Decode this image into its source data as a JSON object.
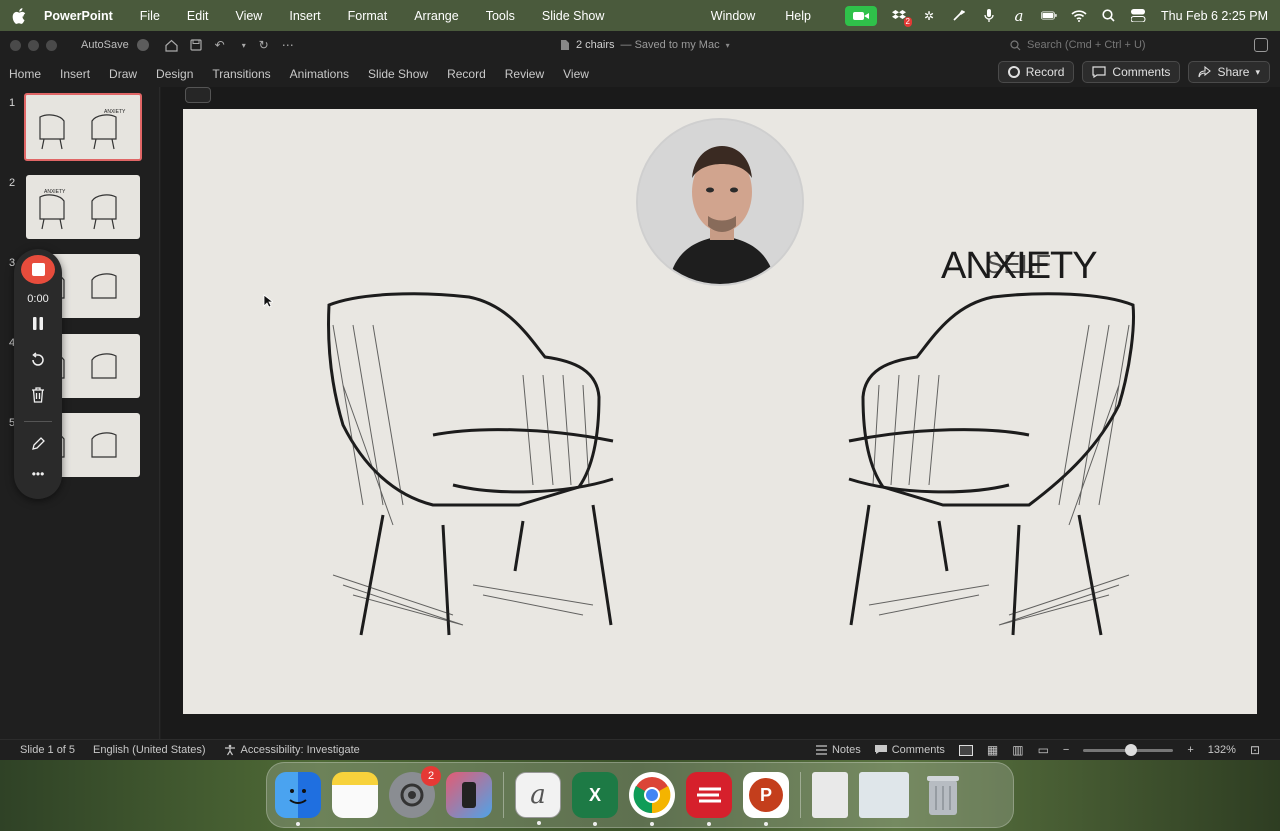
{
  "menubar": {
    "app": "PowerPoint",
    "items": [
      "File",
      "Edit",
      "View",
      "Insert",
      "Format",
      "Arrange",
      "Tools",
      "Slide Show"
    ],
    "right_items": [
      "Window",
      "Help"
    ],
    "datetime": "Thu Feb 6  2:25 PM",
    "notification_badge": "2"
  },
  "titlebar": {
    "autosave_label": "AutoSave",
    "doc_name": "2 chairs",
    "saved_status": "— Saved to my Mac",
    "search_placeholder": "Search (Cmd + Ctrl + U)"
  },
  "ribbon": {
    "tabs": [
      "Home",
      "Insert",
      "Draw",
      "Design",
      "Transitions",
      "Animations",
      "Slide Show",
      "Record",
      "Review",
      "View"
    ],
    "record_label": "Record",
    "comments_label": "Comments",
    "share_label": "Share"
  },
  "slides": {
    "numbers": [
      "1",
      "2",
      "3",
      "4",
      "5"
    ],
    "thumb_text": "ANXIETY"
  },
  "recorder": {
    "time": "0:00"
  },
  "slide": {
    "title": "ANXIETY",
    "overlay_text": "SELF"
  },
  "status": {
    "slide_info": "Slide 1 of 5",
    "language": "English (United States)",
    "accessibility": "Accessibility: Investigate",
    "notes": "Notes",
    "comments": "Comments",
    "zoom": "132%"
  },
  "dock": {
    "settings_badge": "2"
  },
  "colors": {
    "accent_red": "#e74c3c",
    "facetime_green": "#2fc14a",
    "active_thumb_border": "#e06666"
  }
}
